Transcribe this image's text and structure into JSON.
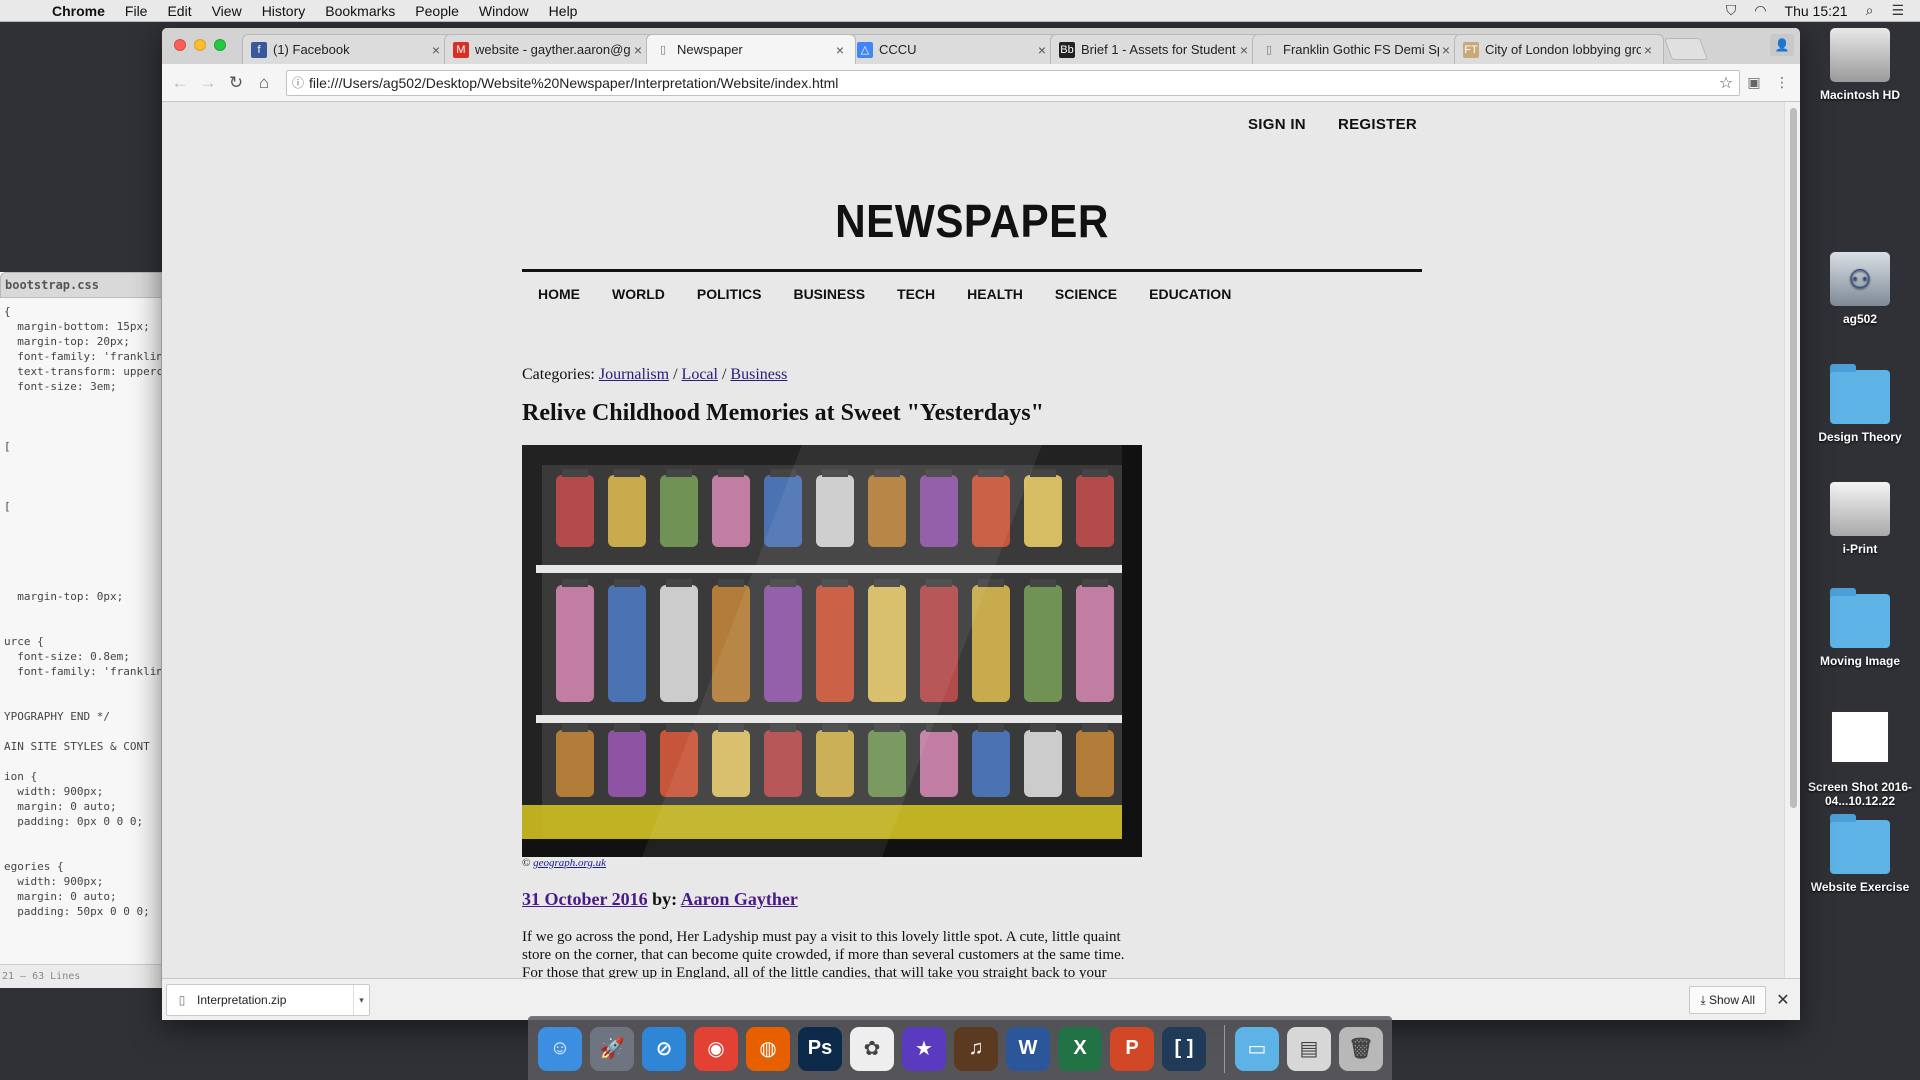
{
  "menubar": {
    "app": "Chrome",
    "items": [
      "File",
      "Edit",
      "View",
      "History",
      "Bookmarks",
      "People",
      "Window",
      "Help"
    ],
    "clock": "Thu 15:21"
  },
  "editor": {
    "tab": "bootstrap.css",
    "lines": [
      "{",
      "  margin-bottom: 15px;",
      "  margin-top: 20px;",
      "  font-family: 'franklin",
      "  text-transform: upperc",
      "  font-size: 3em;",
      "",
      "",
      "",
      "[",
      "",
      "",
      "",
      "[",
      "",
      "",
      "",
      "",
      "",
      "  margin-top: 0px;",
      "",
      "",
      "urce {",
      "  font-size: 0.8em;",
      "  font-family: 'franklin",
      "",
      "",
      "YPOGRAPHY END */",
      "",
      "AIN SITE STYLES & CONT",
      "",
      "ion {",
      "  width: 900px;",
      "  margin: 0 auto;",
      "  padding: 0px 0 0 0;",
      "",
      "",
      "egories {",
      "  width: 900px;",
      "  margin: 0 auto;",
      "  padding: 50px 0 0 0;"
    ],
    "status": "21 — 63 Lines"
  },
  "browser": {
    "tabs": [
      {
        "title": "(1) Facebook",
        "icon": "facebook-icon",
        "glyph": "f",
        "color": "#3b5998"
      },
      {
        "title": "website - gayther.aaron@gm",
        "icon": "gmail-icon",
        "glyph": "M",
        "color": "#d93025"
      },
      {
        "title": "Newspaper",
        "icon": "page-icon",
        "glyph": "▯",
        "color": "#777777"
      },
      {
        "title": "CCCU",
        "icon": "drive-icon",
        "glyph": "△",
        "color": "#4285f4"
      },
      {
        "title": "Brief 1 - Assets for Student",
        "icon": "blackboard-icon",
        "glyph": "Bb",
        "color": "#222222"
      },
      {
        "title": "Franklin Gothic FS Demi Sp",
        "icon": "page-icon",
        "glyph": "▯",
        "color": "#777777"
      },
      {
        "title": "City of London lobbying gro",
        "icon": "ft-icon",
        "glyph": "FT",
        "color": "#c9a87a"
      }
    ],
    "active_tab": 2,
    "url": "file:///Users/ag502/Desktop/Website%20Newspaper/Interpretation/Website/index.html"
  },
  "page": {
    "user_nav": [
      "SIGN IN",
      "REGISTER"
    ],
    "masthead": "NEWSPAPER",
    "main_nav": [
      "HOME",
      "WORLD",
      "POLITICS",
      "BUSINESS",
      "TECH",
      "HEALTH",
      "SCIENCE",
      "EDUCATION"
    ],
    "categories_label": "Categories:",
    "categories": [
      "Journalism",
      "Local",
      "Business"
    ],
    "categories_seps": [
      " / ",
      " / "
    ],
    "headline": "Relive Childhood Memories at Sweet \"Yesterdays\"",
    "caption_prefix": "© ",
    "caption_link": "geograph.org.uk",
    "date": "31 October 2016",
    "by": " by: ",
    "author": "Aaron Gayther",
    "body": "If we go across the pond, Her Ladyship must pay a visit to this lovely little spot. A cute, little quaint store on the corner, that can become quite crowded, if more than several customers at the same time. For those that grew up in England, all of the little candies, that will take you straight back to your childhood. Little glass jars every where, pick what you want, it will be weighed"
  },
  "downloads": {
    "file": "Interpretation.zip",
    "show_all": "Show All"
  },
  "desktop": [
    {
      "label": "Macintosh HD",
      "kind": "disk"
    },
    {
      "label": "ag502",
      "kind": "server"
    },
    {
      "label": "Design Theory",
      "kind": "folder"
    },
    {
      "label": "i-Print",
      "kind": "printer"
    },
    {
      "label": "Moving Image",
      "kind": "folder"
    },
    {
      "label": "Screen Shot 2016-04...10.12.22",
      "kind": "shot"
    },
    {
      "label": "Website Exercise",
      "kind": "folder"
    }
  ],
  "dock": [
    {
      "name": "finder-icon",
      "glyph": "☺",
      "color": "#3b8ee0"
    },
    {
      "name": "launchpad-icon",
      "glyph": "🚀",
      "color": "#6f7580"
    },
    {
      "name": "safari-icon",
      "glyph": "⊘",
      "color": "#2f86d6"
    },
    {
      "name": "chrome-icon",
      "glyph": "◉",
      "color": "#e34133"
    },
    {
      "name": "firefox-icon",
      "glyph": "◍",
      "color": "#e66000"
    },
    {
      "name": "photoshop-icon",
      "glyph": "Ps",
      "color": "#0d2a4a"
    },
    {
      "name": "photos-icon",
      "glyph": "✿",
      "color": "#eeeeee"
    },
    {
      "name": "imovie-icon",
      "glyph": "★",
      "color": "#5a3bc0"
    },
    {
      "name": "garageband-icon",
      "glyph": "♫",
      "color": "#5b3a1f"
    },
    {
      "name": "word-icon",
      "glyph": "W",
      "color": "#2b579a"
    },
    {
      "name": "excel-icon",
      "glyph": "X",
      "color": "#217346"
    },
    {
      "name": "powerpoint-icon",
      "glyph": "P",
      "color": "#d24726"
    },
    {
      "name": "brackets-icon",
      "glyph": "[ ]",
      "color": "#1f3b57"
    },
    {
      "name": "documents-folder-icon",
      "glyph": "▭",
      "color": "#5db2e6"
    },
    {
      "name": "downloads-stack-icon",
      "glyph": "▤",
      "color": "#d7d7d7"
    },
    {
      "name": "trash-icon",
      "glyph": "🗑",
      "color": "#b8b8b8"
    }
  ]
}
